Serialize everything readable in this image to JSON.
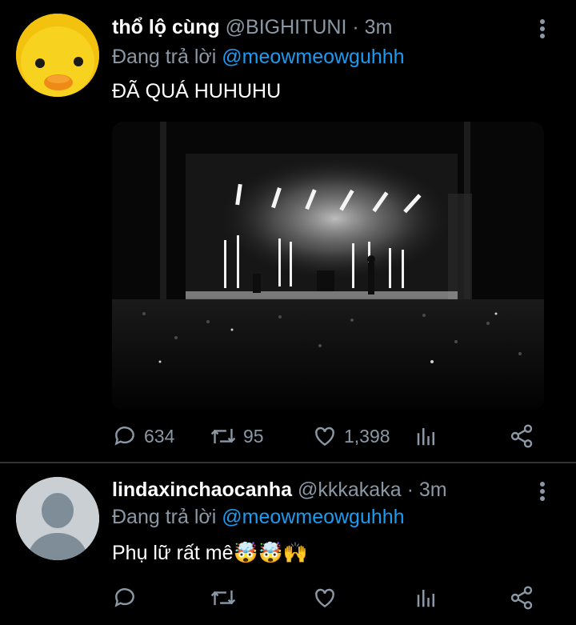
{
  "tweets": [
    {
      "display_name": "thổ lộ cùng",
      "handle": "@BIGHITUNI",
      "time": "· 3m",
      "reply_prefix": "Đang trả lời",
      "reply_to": "@meowmeowguhhh",
      "text": "ĐÃ QUÁ HUHUHU",
      "avatar_icon": "duck-avatar",
      "has_media": true,
      "counts": {
        "replies": "634",
        "retweets": "95",
        "likes": "1,398"
      }
    },
    {
      "display_name": "lindaxinchaocanha",
      "handle": "@kkkakaka",
      "time": "· 3m",
      "reply_prefix": "Đang trả lời",
      "reply_to": "@meowmeowguhhh",
      "text": "Phụ lữ rất mê🤯🤯🙌",
      "avatar_icon": "default-user-avatar",
      "has_media": false,
      "counts": {
        "replies": "",
        "retweets": "",
        "likes": ""
      }
    }
  ],
  "colors": {
    "background": "#000000",
    "muted": "#8b98a5",
    "accent": "#1d9bf0",
    "divider": "#2f3336"
  }
}
